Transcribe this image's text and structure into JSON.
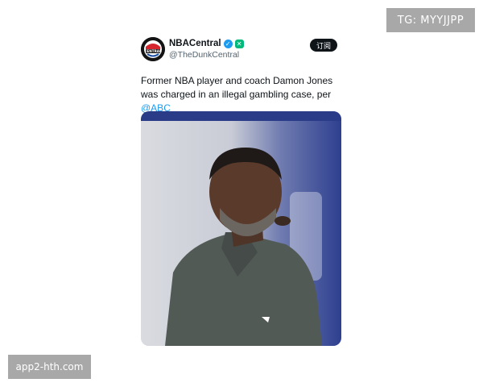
{
  "watermarks": {
    "top_right": "TG: MYYJJPP",
    "bottom_left": "app2-hth.com"
  },
  "post": {
    "author": {
      "display_name": "NBACentral",
      "handle": "@TheDunkCentral",
      "avatar_icon": "nbacentral-logo-icon",
      "badges": [
        "verified-check-icon",
        "green-x-badge-icon"
      ]
    },
    "subscribe_label": "订阅",
    "text_before_mention": "Former NBA player and coach Damon Jones was charged in an illegal gambling case, per ",
    "mention": "@ABC",
    "media_alt": "photo-of-man-in-grey-polo"
  },
  "colors": {
    "mention": "#1d9bf0",
    "verified": "#1d9bf0",
    "subscribe_bg": "#0f1419",
    "watermark_bg": "#a8a8a8"
  }
}
